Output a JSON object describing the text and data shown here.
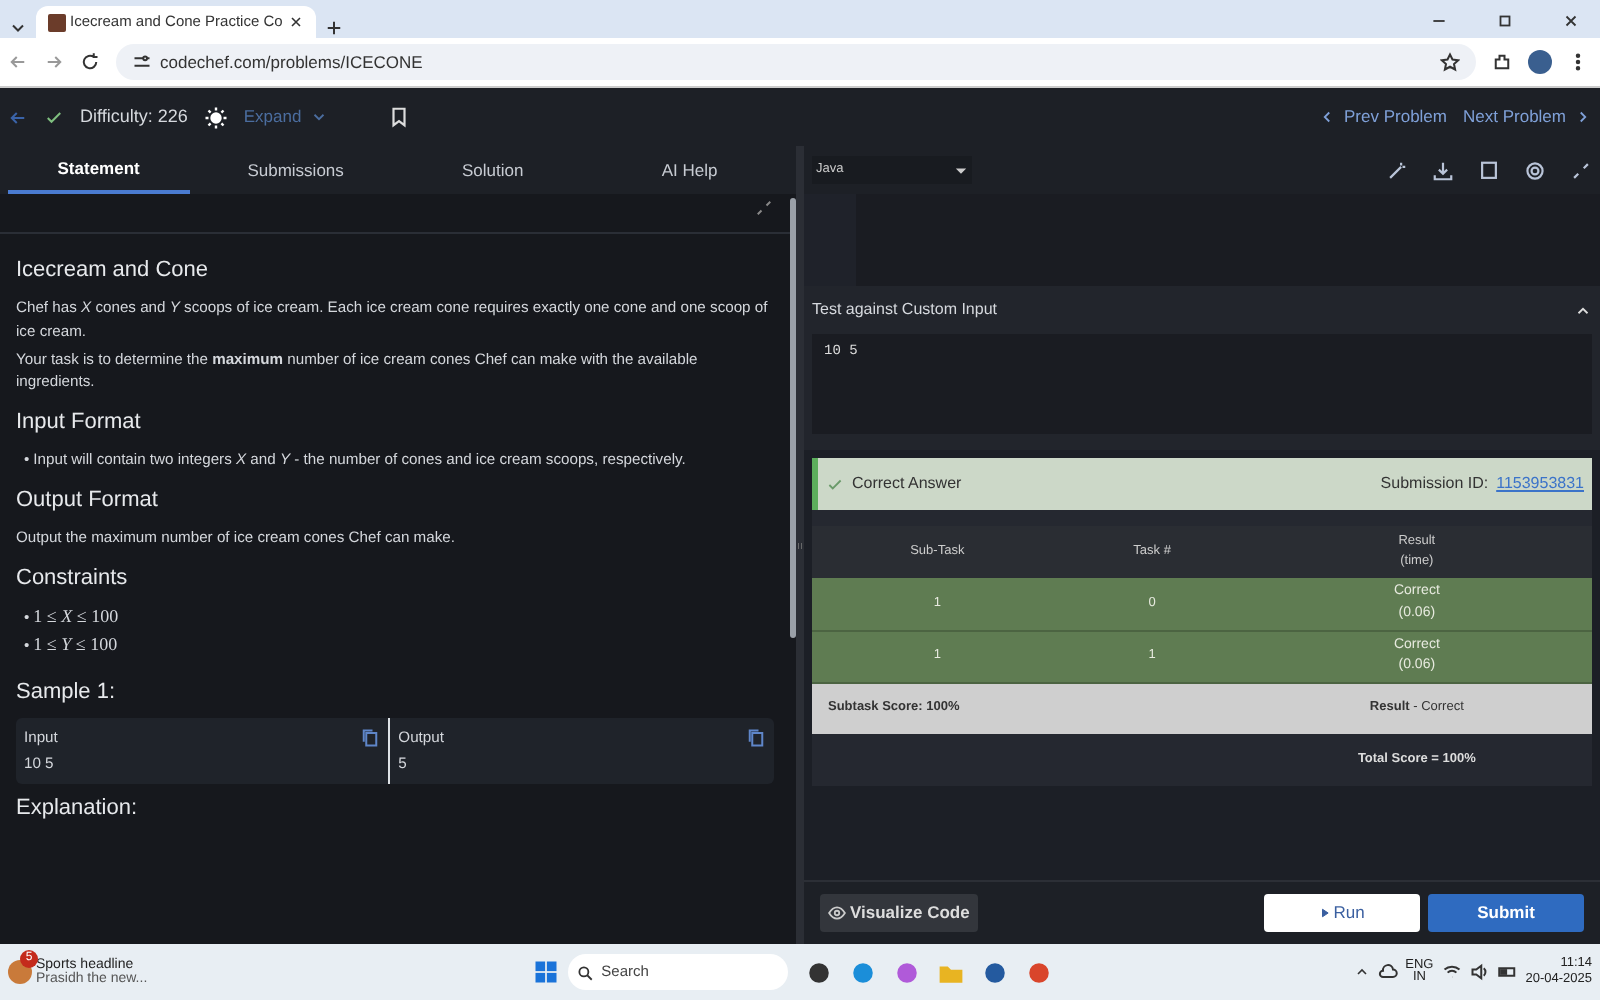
{
  "browser": {
    "tab_title": "Icecream and Cone Practice Co",
    "url": "codechef.com/problems/ICECONE"
  },
  "header": {
    "solved": true,
    "difficulty": "Difficulty: 226",
    "expand": "Expand",
    "prev": "Prev Problem",
    "next": "Next Problem"
  },
  "tabs": [
    {
      "label": "Statement",
      "selected": true
    },
    {
      "label": "Submissions",
      "selected": false
    },
    {
      "label": "Solution",
      "selected": false
    },
    {
      "label": "AI Help",
      "selected": false
    }
  ],
  "problem": {
    "title": "Icecream and Cone",
    "paragraphs": [
      "Chef has *X* cones and *Y* scoops of ice cream. Each ice cream cone requires exactly one cone and one scoop of ice cream.",
      "Your task is to determine the **maximum** number of ice cream cones Chef can make with the available ingredients."
    ],
    "sections": [
      {
        "heading": "Input Format",
        "kind": "list",
        "marker": "•",
        "items": [
          "Input will contain two integers *X* and *Y* - the number of cones and ice cream scoops, respectively."
        ]
      },
      {
        "heading": "Output Format",
        "kind": "text",
        "items": [
          "Output the maximum number of ice cream cones Chef can make."
        ]
      },
      {
        "heading": "Constraints",
        "kind": "math",
        "marker": "•",
        "items": [
          "1 ≤ *X* ≤ 100",
          "1 ≤ *Y* ≤ 100"
        ]
      }
    ],
    "sample": {
      "heading": "Sample 1:",
      "input_label": "Input",
      "input": "10 5",
      "output_label": "Output",
      "output": "5"
    },
    "explanation": "Explanation:"
  },
  "editor": {
    "language": "Java"
  },
  "custom_input": {
    "title": "Test against Custom Input",
    "expanded": true,
    "value": "10 5"
  },
  "result": {
    "status": "Correct Answer",
    "submission_label": "Submission ID:",
    "submission_id": "1153953831",
    "columns": [
      [
        "Sub-Task"
      ],
      [
        "Task #"
      ],
      [
        "Result",
        "(time)"
      ]
    ],
    "rows": [
      {
        "subtask": "1",
        "task": "0",
        "verdict": "Correct",
        "time": "(0.06)"
      },
      {
        "subtask": "1",
        "task": "1",
        "verdict": "Correct",
        "time": "(0.06)"
      }
    ],
    "subtask_score": "Subtask Score: 100%",
    "result_label": "Result",
    "result_value": " - Correct",
    "total": "Total Score = 100%"
  },
  "buttons": {
    "visualize": "Visualize Code",
    "run": "Run",
    "submit": "Submit"
  },
  "taskbar": {
    "news_badge": "5",
    "news_title": "Sports headline",
    "news_text": "Prasidh the new...",
    "search": "Search",
    "lang": "ENG",
    "region": "IN",
    "time": "11:14",
    "date": "20-04-2025"
  }
}
